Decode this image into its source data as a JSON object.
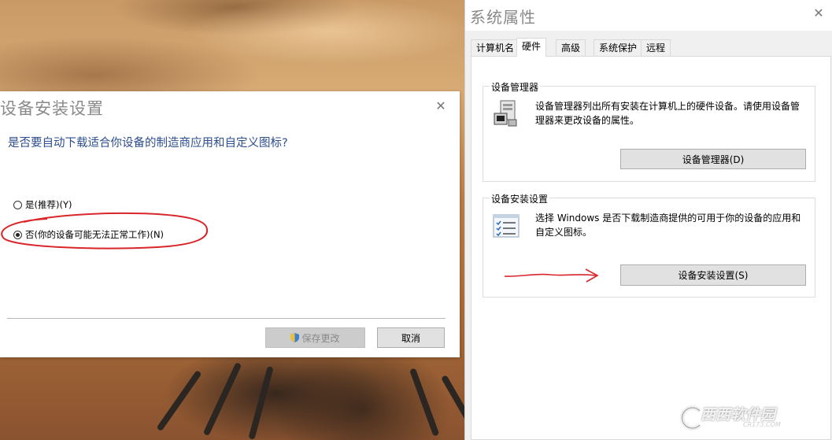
{
  "install_dialog": {
    "title": "设备安装设置",
    "question": "是否要自动下载适合你设备的制造商应用和自定义图标?",
    "option_yes": "是(推荐)(Y)",
    "option_no": "否(你的设备可能无法正常工作)(N)",
    "selected": "option_no",
    "save_label": "保存更改",
    "cancel_label": "取消"
  },
  "system_properties": {
    "title": "系统属性",
    "tabs": [
      {
        "label": "计算机名"
      },
      {
        "label": "硬件"
      },
      {
        "label": "高级"
      },
      {
        "label": "系统保护"
      },
      {
        "label": "远程"
      }
    ],
    "active_tab": "硬件",
    "device_manager_group": {
      "label": "设备管理器",
      "description": "设备管理器列出所有安装在计算机上的硬件设备。请使用设备管理器来更改设备的属性。",
      "button_label": "设备管理器(D)"
    },
    "device_install_group": {
      "label": "设备安装设置",
      "description": "选择 Windows 是否下载制造商提供的可用于你的设备的应用和自定义图标。",
      "button_label": "设备安装设置(S)"
    }
  },
  "watermark": {
    "main": "西西软件园",
    "sub": "CR173.COM"
  },
  "colors": {
    "question_text": "#2c4d8e",
    "annotation_red": "#d9262b",
    "button_face": "#e1e1e1"
  }
}
